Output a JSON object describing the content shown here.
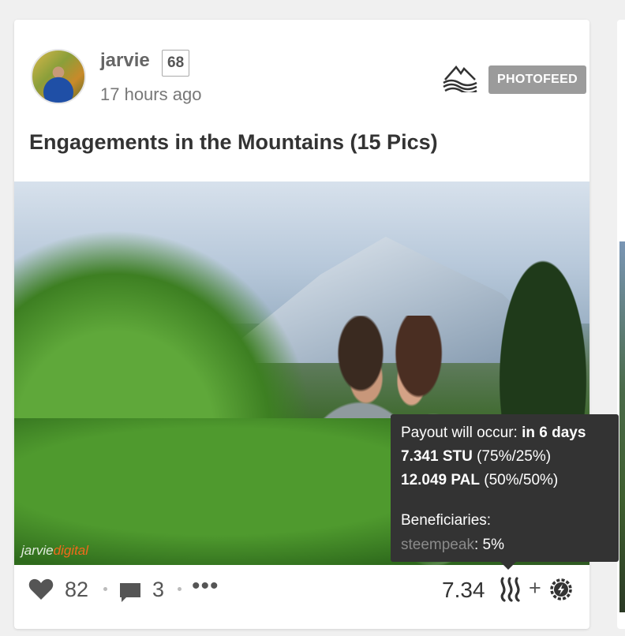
{
  "post": {
    "author": "jarvie",
    "reputation": "68",
    "time_ago": "17 hours ago",
    "community_badge": "PHOTOFEED",
    "community_logo_icon": "mountain-logo-icon",
    "title": "Engagements in the Mountains (15 Pics)",
    "watermark": {
      "part1": "jarvie",
      "part2": "digital"
    }
  },
  "footer": {
    "votes": "82",
    "comments": "3",
    "more": "•••",
    "payout": "7.34",
    "plus": "+",
    "icons": [
      "heart-icon",
      "comment-icon",
      "steem-icon",
      "gear-icon"
    ]
  },
  "tooltip": {
    "payout_label": "Payout will occur: ",
    "payout_when": "in 6 days",
    "stu_amount": "7.341 STU",
    "stu_split": " (75%/25%)",
    "pal_amount": "12.049 PAL",
    "pal_split": " (50%/50%)",
    "beneficiaries_label": "Beneficiaries:",
    "beneficiary_name": "steempeak",
    "beneficiary_pct": ": 5%"
  },
  "colors": {
    "badge_bg": "#9b9b9b",
    "tooltip_bg": "#333333",
    "watermark_accent": "#f06a1c"
  }
}
